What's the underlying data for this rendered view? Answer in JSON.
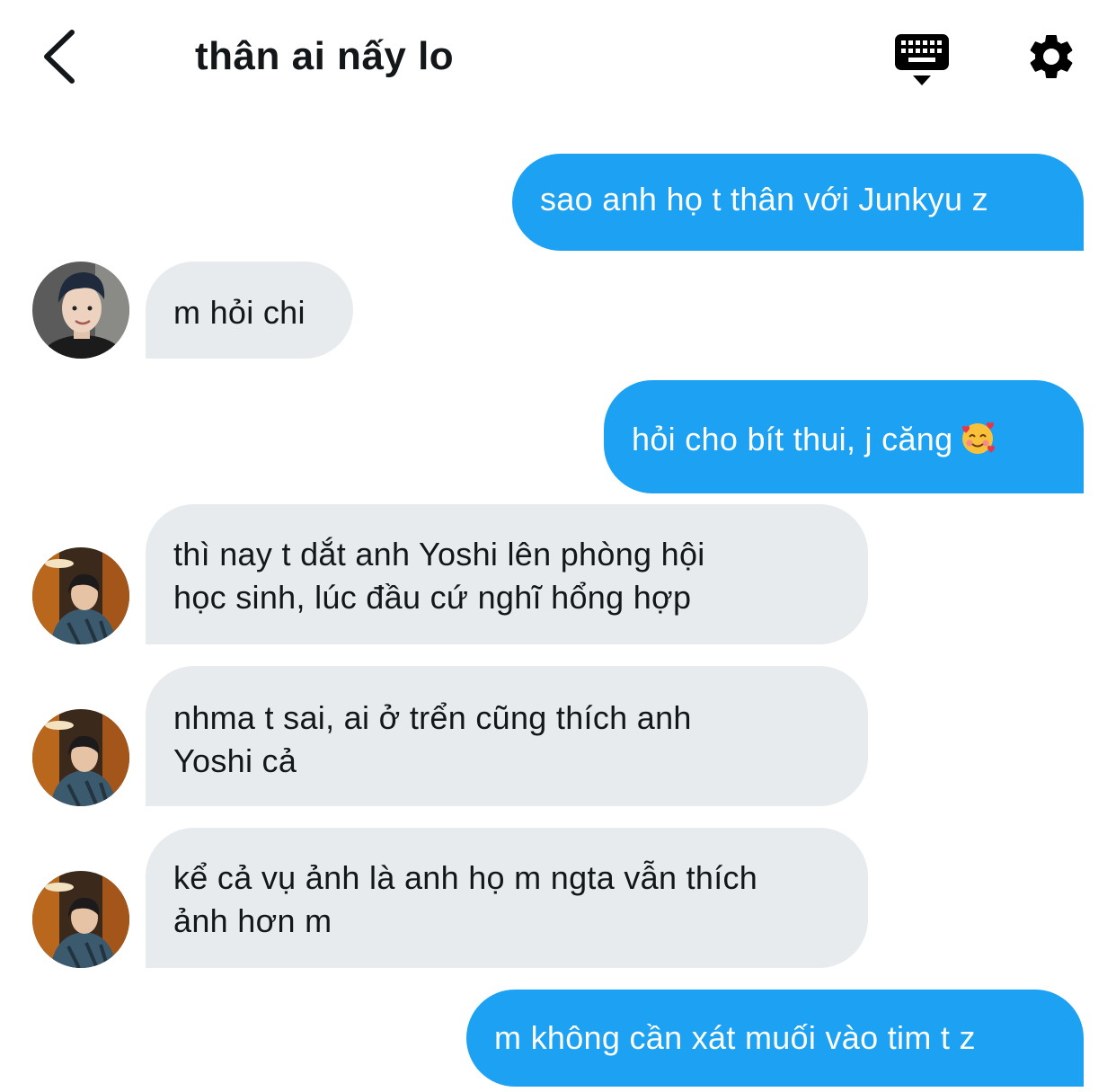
{
  "header": {
    "title": "thân ai nấy lo",
    "back_icon": "chevron-left-icon",
    "keyboard_icon": "keyboard-hide-icon",
    "settings_icon": "gear-icon"
  },
  "colors": {
    "outgoing_bubble": "#1da1f2",
    "incoming_bubble": "#e7ebee",
    "text_dark": "#14171a"
  },
  "messages": [
    {
      "direction": "outgoing",
      "text": "sao anh họ t thân với Junkyu z"
    },
    {
      "direction": "incoming",
      "text": "m hỏi chi"
    },
    {
      "direction": "outgoing",
      "text": "hỏi cho bít thui, j căng",
      "emoji": "smiling-face-with-hearts"
    },
    {
      "direction": "incoming",
      "lines": [
        "thì nay t dắt anh Yoshi lên phòng hội",
        "học sinh, lúc đầu cứ nghĩ hổng hợp"
      ]
    },
    {
      "direction": "incoming",
      "lines": [
        "nhma t sai, ai ở trển cũng thích anh",
        "Yoshi cả"
      ]
    },
    {
      "direction": "incoming",
      "lines": [
        "kể cả vụ ảnh là anh họ m ngta vẫn thích",
        "ảnh hơn m"
      ]
    },
    {
      "direction": "outgoing",
      "text": "m không cần xát muối vào tim t z"
    }
  ]
}
